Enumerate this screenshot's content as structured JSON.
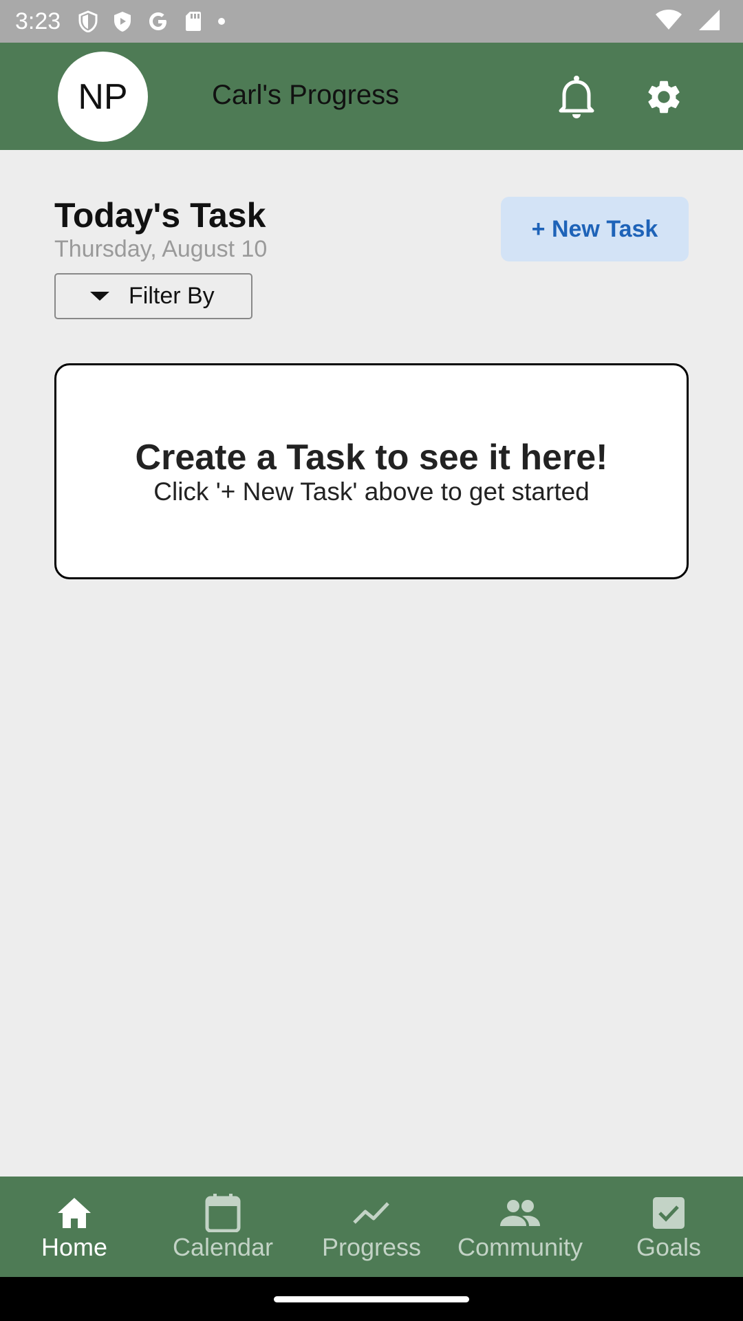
{
  "status_bar": {
    "time": "3:23"
  },
  "header": {
    "avatar_initials": "NP",
    "title": "Carl's Progress"
  },
  "tasks": {
    "heading": "Today's Task",
    "date": "Thursday, August 10",
    "new_task_label": "+ New Task",
    "filter_label": "Filter By",
    "empty_title": "Create a Task to see it here!",
    "empty_subtitle": "Click '+ New Task' above to get started"
  },
  "bottom_nav": {
    "items": [
      {
        "label": "Home",
        "icon": "home-icon",
        "active": true
      },
      {
        "label": "Calendar",
        "icon": "calendar-icon",
        "active": false
      },
      {
        "label": "Progress",
        "icon": "trending-icon",
        "active": false
      },
      {
        "label": "Community",
        "icon": "people-icon",
        "active": false
      },
      {
        "label": "Goals",
        "icon": "checkbox-icon",
        "active": false
      }
    ]
  },
  "colors": {
    "app_bar": "#4e7b55",
    "new_task_bg": "#d3e3f6",
    "new_task_text": "#1e63b8",
    "background": "#ededed"
  }
}
